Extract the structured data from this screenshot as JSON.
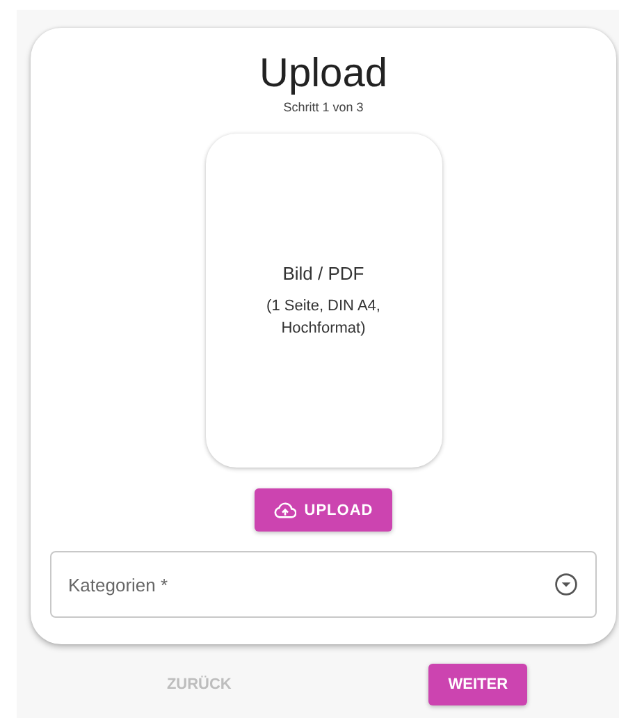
{
  "title": "Upload",
  "step": "Schritt 1 von 3",
  "dropzone": {
    "label": "Bild / PDF",
    "hint": "(1 Seite, DIN A4, Hochformat)"
  },
  "upload_button": {
    "label": "UPLOAD"
  },
  "category_select": {
    "placeholder": "Kategorien *"
  },
  "footer_buttons": [
    {
      "label": "ZURÜCK",
      "disabled": true
    },
    {
      "label": "WEITER",
      "disabled": false
    }
  ]
}
